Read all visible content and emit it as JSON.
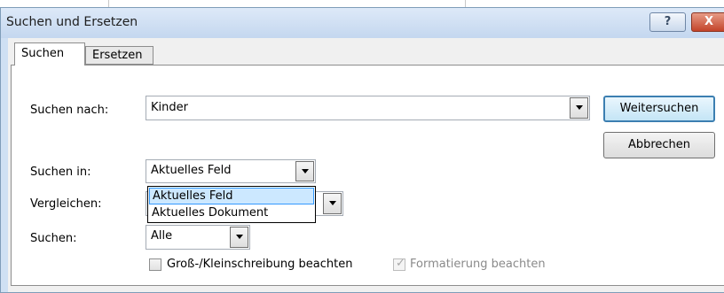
{
  "window": {
    "title": "Suchen und Ersetzen",
    "help_label": "?",
    "close_label": "X"
  },
  "tabs": [
    {
      "label": "Suchen",
      "active": true
    },
    {
      "label": "Ersetzen",
      "active": false
    }
  ],
  "form": {
    "find_what": {
      "label": "Suchen nach:",
      "value": "Kinder"
    },
    "look_in": {
      "label": "Suchen in:",
      "value": "Aktuelles Feld",
      "options": [
        "Aktuelles Feld",
        "Aktuelles Dokument"
      ],
      "highlighted_option": "Aktuelles Feld"
    },
    "match": {
      "label": "Vergleichen:",
      "value": ""
    },
    "search_direction": {
      "label": "Suchen:",
      "value": "Alle"
    },
    "match_case": {
      "label": "Groß-/Kleinschreibung beachten",
      "checked": false
    },
    "search_formatted": {
      "label": "Formatierung beachten",
      "checked": true,
      "disabled": true
    }
  },
  "buttons": {
    "find_next": "Weitersuchen",
    "cancel": "Abbrechen"
  },
  "icons": [
    "help-icon",
    "close-icon",
    "chevron-down-icon",
    "checkmark-icon"
  ],
  "colors": {
    "titlebar": "#c4d7ef",
    "close_button": "#c3442a",
    "selection": "#cce8ff",
    "default_button_border": "#3c7fb1"
  }
}
